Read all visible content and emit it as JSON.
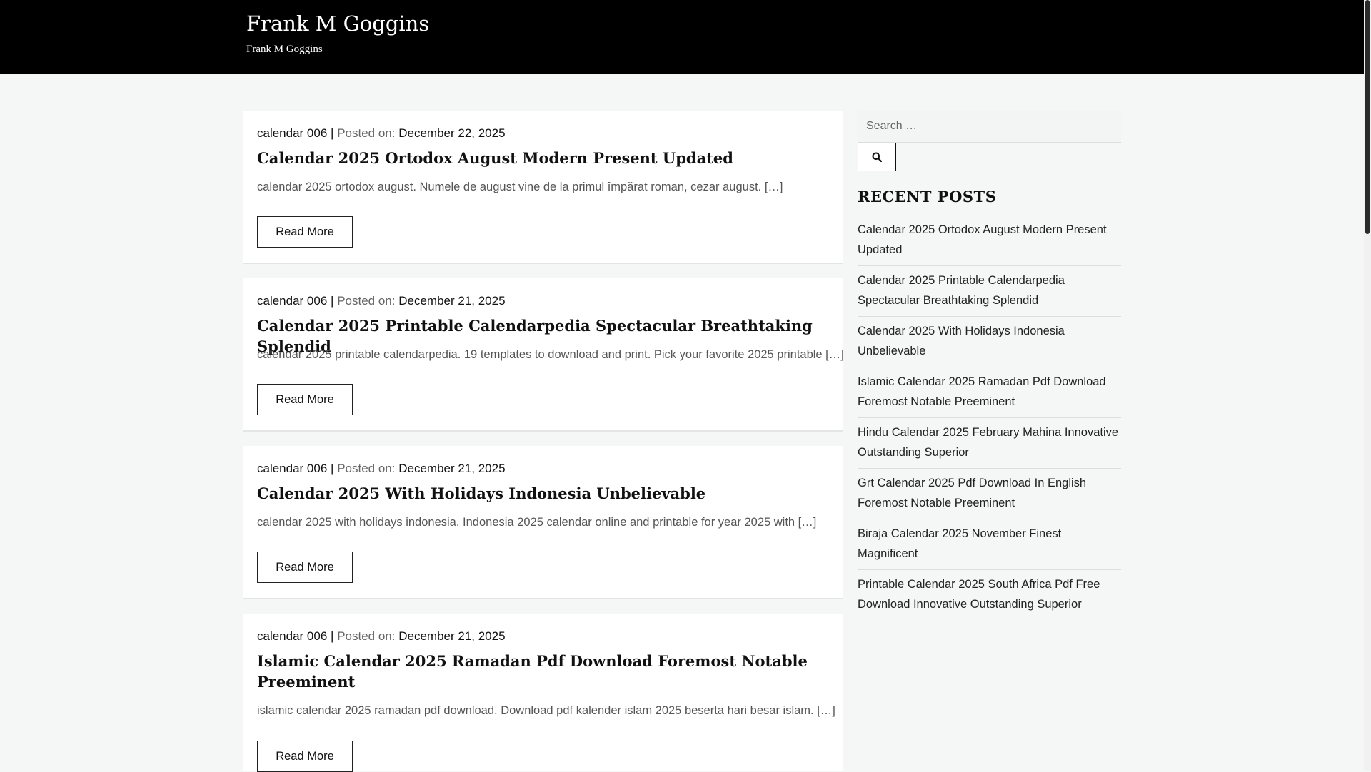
{
  "site": {
    "title": "Frank M Goggins",
    "description": "Frank M Goggins"
  },
  "posts": [
    {
      "category": "calendar 006",
      "separator": "|",
      "posted_label": "Posted on:",
      "date": "December 22, 2025",
      "title": "Calendar 2025 Ortodox August Modern Present Updated",
      "excerpt": "calendar 2025 ortodox august. Numele de august vine de la primul împărat roman, cezar august. […]",
      "read_more": "Read More"
    },
    {
      "category": "calendar 006",
      "separator": "|",
      "posted_label": "Posted on:",
      "date": "December 21, 2025",
      "title": "Calendar 2025 Printable Calendarpedia Spectacular Breathtaking Splendid",
      "excerpt": "calendar 2025 printable calendarpedia. 19 templates to download and print. Pick your favorite 2025 printable […]",
      "read_more": "Read More"
    },
    {
      "category": "calendar 006",
      "separator": "|",
      "posted_label": "Posted on:",
      "date": "December 21, 2025",
      "title": "Calendar 2025 With Holidays Indonesia Unbelievable",
      "excerpt": "calendar 2025 with holidays indonesia. Indonesia 2025 calendar online and printable for year 2025 with […]",
      "read_more": "Read More"
    },
    {
      "category": "calendar 006",
      "separator": "|",
      "posted_label": "Posted on:",
      "date": "December 21, 2025",
      "title": "Islamic Calendar 2025 Ramadan Pdf Download Foremost Notable Preeminent",
      "excerpt": "islamic calendar 2025 ramadan pdf download. Download pdf kalender islam 2025 beserta hari besar islam. […]",
      "read_more": "Read More"
    }
  ],
  "sidebar": {
    "search": {
      "placeholder": "Search …",
      "icon": "search-icon"
    },
    "recent_heading": "RECENT POSTS",
    "recent_posts": [
      "Calendar 2025 Ortodox August Modern Present Updated",
      "Calendar 2025 Printable Calendarpedia Spectacular Breathtaking Splendid",
      "Calendar 2025 With Holidays Indonesia Unbelievable",
      "Islamic Calendar 2025 Ramadan Pdf Download Foremost Notable Preeminent",
      "Hindu Calendar 2025 February Mahina Innovative Outstanding Superior",
      "Grt Calendar 2025 Pdf Download In English Foremost Notable Preeminent",
      "Biraja Calendar 2025 November Finest Magnificent",
      "Printable Calendar 2025 South Africa Pdf Free Download Innovative Outstanding Superior"
    ]
  },
  "colors": {
    "header_bg": "#000000",
    "page_bg": "#f5f6f6",
    "card_bg": "#ffffff",
    "text": "#111111"
  }
}
